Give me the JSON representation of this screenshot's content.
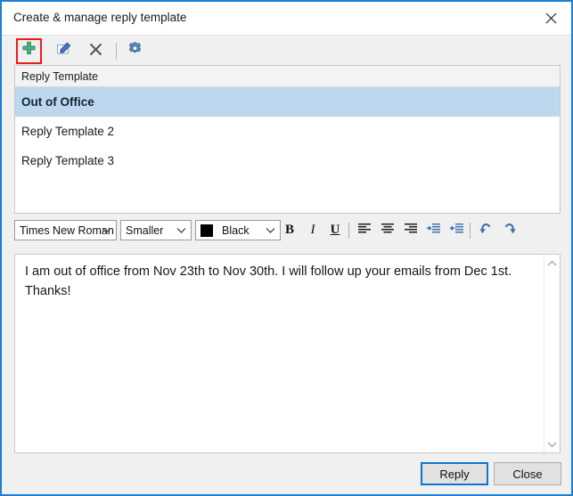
{
  "window": {
    "title": "Create & manage reply template",
    "close_icon": "close-icon",
    "border_color": "#1b7fd4"
  },
  "toolbar": {
    "items": [
      {
        "name": "add-template",
        "icon": "plus-icon",
        "selected": true,
        "color": "#3aa06a"
      },
      {
        "name": "edit-template",
        "icon": "edit-pencil-icon",
        "color": "#3f6fb5"
      },
      {
        "name": "delete-template",
        "icon": "x-delete-icon",
        "color": "#555555"
      },
      {
        "name": "settings",
        "icon": "gear-icon",
        "color": "#4a7ab0"
      }
    ],
    "selection_box_color": "#ef1b1b"
  },
  "list": {
    "header": "Reply Template",
    "rows": [
      {
        "label": "Out of Office",
        "selected": true
      },
      {
        "label": "Reply Template 2",
        "selected": false
      },
      {
        "label": "Reply Template 3",
        "selected": false
      }
    ],
    "selected_background": "#bdd7ee"
  },
  "format_bar": {
    "font_family": "Times New Roman",
    "font_size": "Smaller",
    "font_color": "Black",
    "font_color_swatch": "#000000",
    "bold_label": "B",
    "italic_label": "I",
    "underline_label": "U",
    "buttons": [
      {
        "name": "bold-button",
        "icon": "bold-icon"
      },
      {
        "name": "italic-button",
        "icon": "italic-icon"
      },
      {
        "name": "underline-button",
        "icon": "underline-icon"
      },
      {
        "name": "align-left-button",
        "icon": "align-left-icon"
      },
      {
        "name": "align-center-button",
        "icon": "align-center-icon"
      },
      {
        "name": "align-right-button",
        "icon": "align-right-icon"
      },
      {
        "name": "indent-increase-button",
        "icon": "indent-increase-icon"
      },
      {
        "name": "indent-decrease-button",
        "icon": "indent-decrease-icon"
      },
      {
        "name": "undo-button",
        "icon": "undo-arrow-icon"
      },
      {
        "name": "redo-button",
        "icon": "redo-arrow-icon"
      }
    ],
    "accent_color": "#3f6fb5"
  },
  "editor": {
    "body_text": "I am out of office from Nov 23th to Nov 30th. I will follow up your emails from Dec 1st. Thanks!",
    "scroll_up_icon": "chevron-up-icon",
    "scroll_down_icon": "chevron-down-icon"
  },
  "footer": {
    "reply_label": "Reply",
    "close_label": "Close",
    "default_button_border": "#0d76d0"
  }
}
